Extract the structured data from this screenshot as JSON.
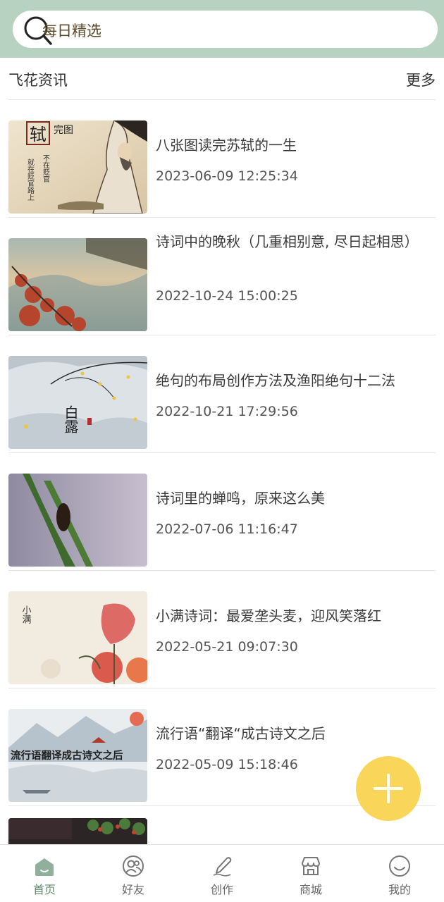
{
  "search": {
    "placeholder": "每日精选"
  },
  "section": {
    "title": "飞花资讯",
    "more": "更多"
  },
  "articles": [
    {
      "title": "八张图读完苏轼的一生",
      "time": "2023-06-09 12:25:34"
    },
    {
      "title": "诗词中的晚秋（几重相别意, 尽日起相思）",
      "time": "2022-10-24 15:00:25"
    },
    {
      "title": "绝句的布局创作方法及渔阳绝句十二法",
      "time": "2022-10-21 17:29:56"
    },
    {
      "title": "诗词里的蝉鸣，原来这么美",
      "time": "2022-07-06 11:16:47"
    },
    {
      "title": "小满诗词：最爱垄头麦，迎风笑落红",
      "time": "2022-05-21 09:07:30"
    },
    {
      "title": "流行语“翻译“成古诗文之后",
      "time": "2022-05-09 15:18:46"
    }
  ],
  "thumb_text": {
    "su": {
      "char": "轼",
      "top": "完图",
      "col1": "就在贬官路上",
      "col2": "不在贬官"
    },
    "bailu": "白露",
    "xiaoman": "小满",
    "liuxing": "流行语翻译成古诗文之后"
  },
  "tabs": [
    {
      "label": "首页",
      "icon": "home-icon",
      "active": true
    },
    {
      "label": "好友",
      "icon": "friends-icon",
      "active": false
    },
    {
      "label": "创作",
      "icon": "pen-icon",
      "active": false
    },
    {
      "label": "商城",
      "icon": "shop-icon",
      "active": false
    },
    {
      "label": "我的",
      "icon": "smile-icon",
      "active": false
    }
  ],
  "colors": {
    "header": "#b7d2c1",
    "fab": "#f9d65a",
    "active_tab": "#5e8a6c"
  }
}
